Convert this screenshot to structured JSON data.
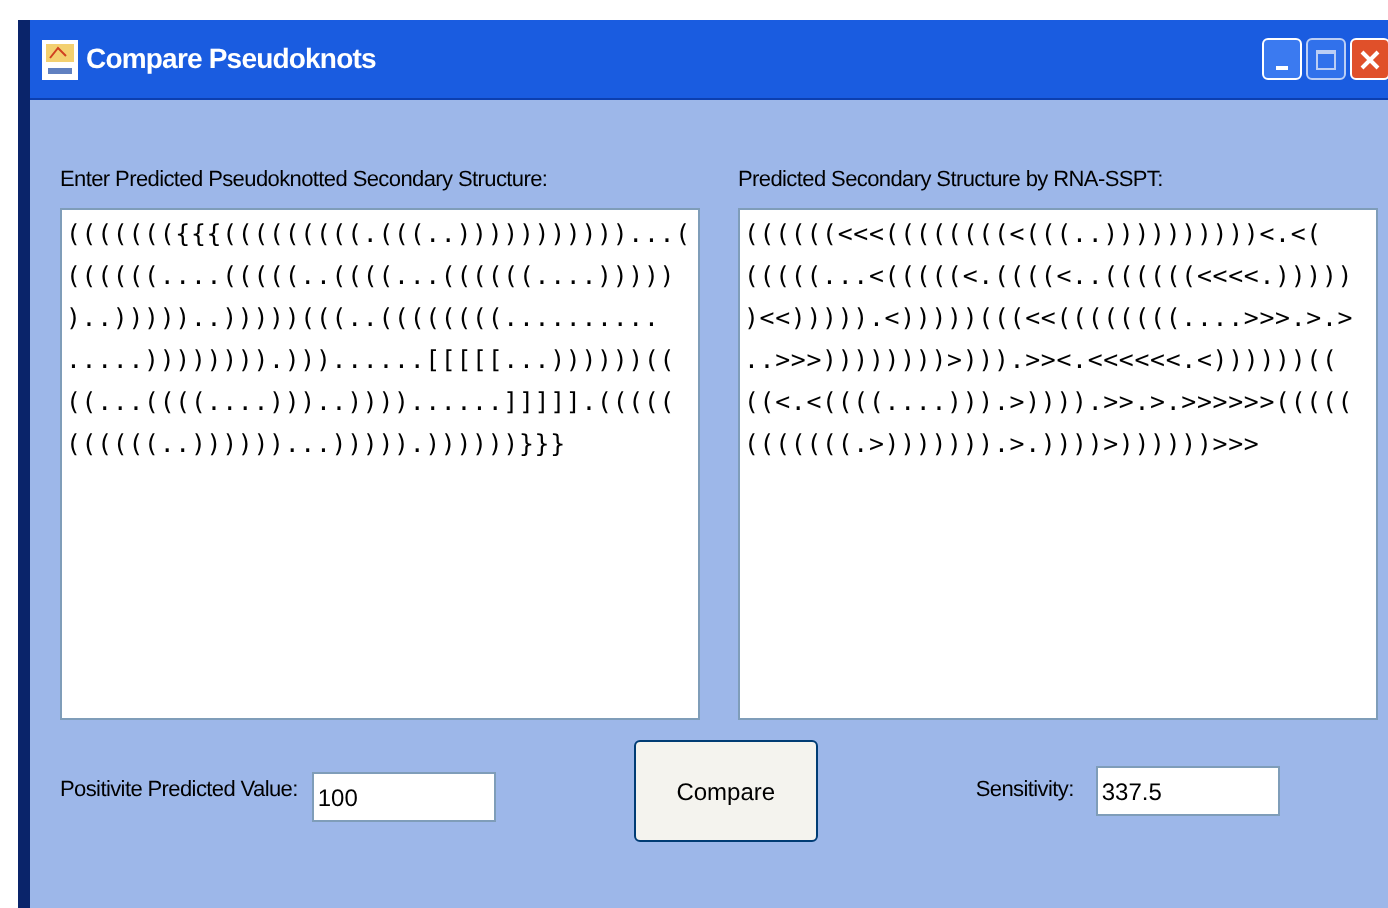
{
  "window": {
    "title": "Compare Pseudoknots"
  },
  "predicted_structure": {
    "label": "Enter Predicted Pseudoknotted Secondary Structure:",
    "lines": [
      "((((((({{{(((((((((.(((..)))))))))))...(",
      "((((((....(((((..((((...((((((....)))))",
      ")..)))))..)))))(((..((((((((..........",
      ".....)))))))).)))......[[[[[...))))))((",
      "((...((((....)))..))))......]]]]].(((((",
      "((((((..))))))...))))).))))))}}}"
    ]
  },
  "sspt_structure": {
    "label": "Predicted Secondary Structure by RNA-SSPT:",
    "lines": [
      "((((((<<<((((((((<(((..))))))))))<.<(",
      "(((((...<(((((<.((((<..((((((<<<<.)))))",
      ")<<))))).<)))))(((<<((((((((....>>>.>.>",
      "..>>>))))))))>))).>><.<<<<<<.<))))))((",
      "((<.<((((....))).>)))).>>.>.>>>>>>(((((",
      "(((((((.>))))))).>.))))>))))))>>>"
    ]
  },
  "ppv": {
    "label": "Positivite Predicted Value:",
    "value": "100"
  },
  "compare_button": {
    "label": "Compare"
  },
  "sensitivity": {
    "label": "Sensitivity:",
    "value": "337.5"
  }
}
